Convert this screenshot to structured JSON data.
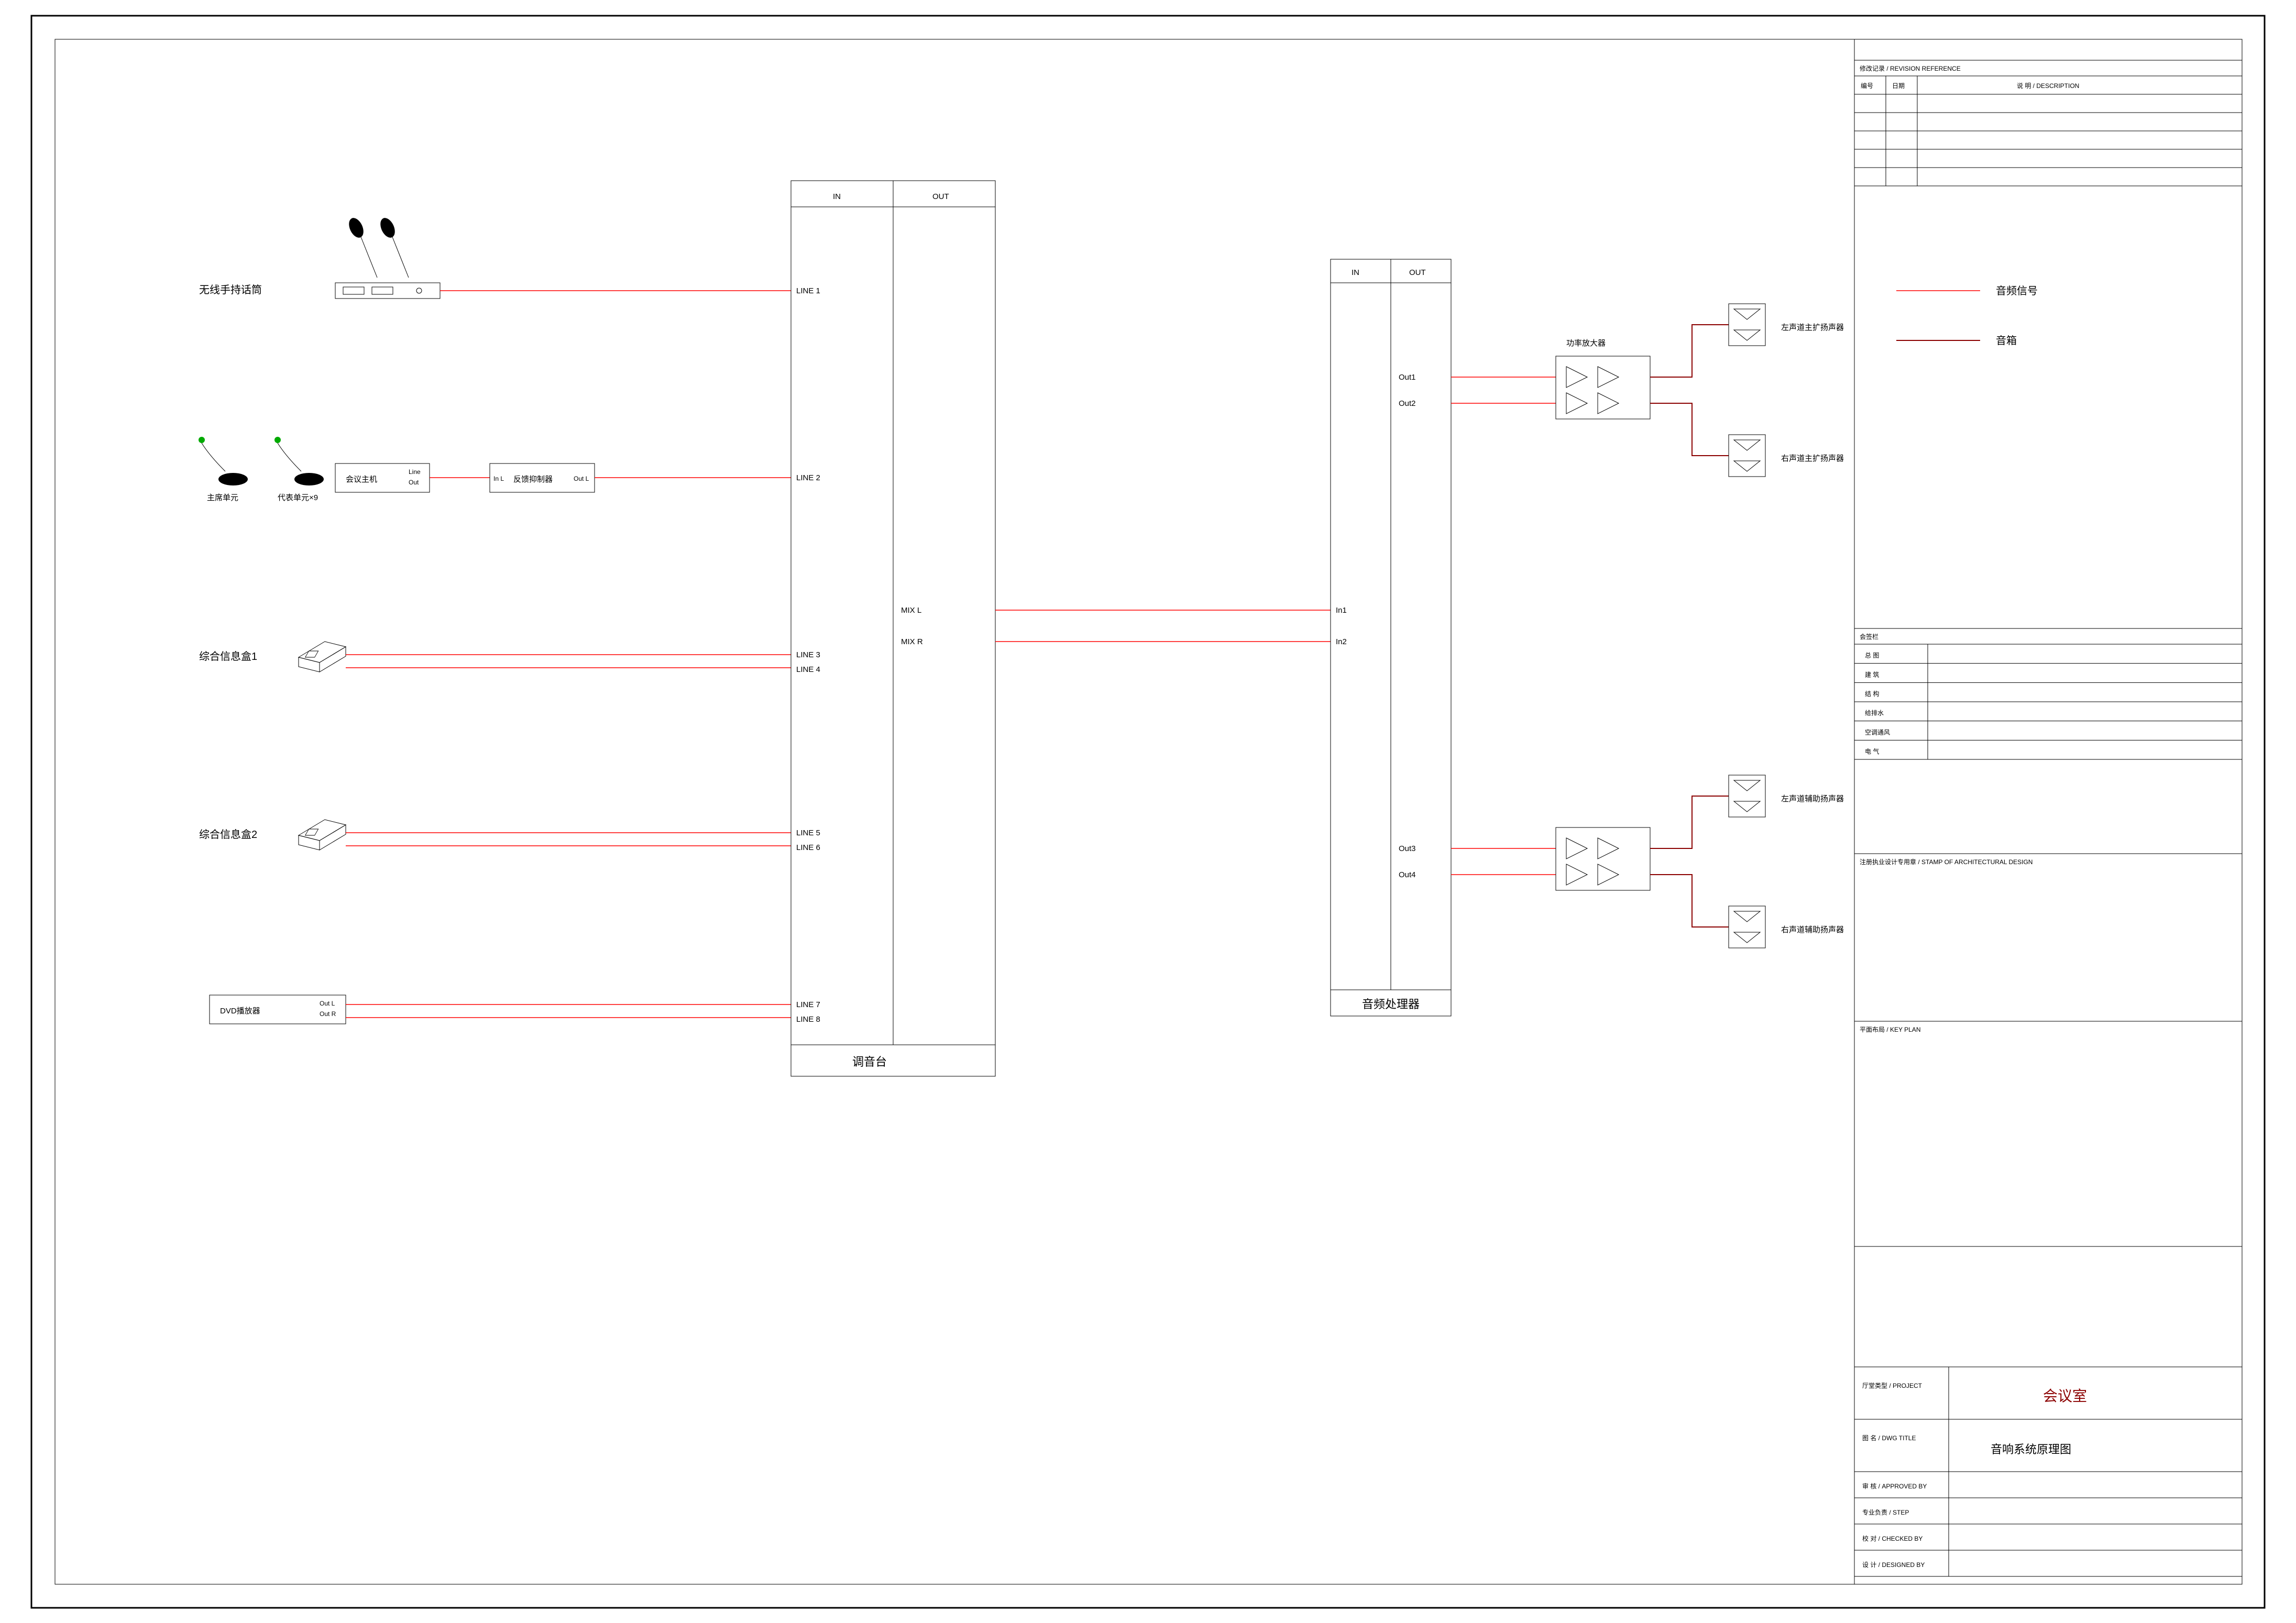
{
  "sources": {
    "wireless_mic": "无线手持话筒",
    "chairman_unit": "主席单元",
    "delegate_unit": "代表单元×9",
    "conf_host": "会议主机",
    "conf_host_line": "Line",
    "conf_host_out": "Out",
    "feedback": "反馈抑制器",
    "feedback_inL": "In L",
    "feedback_outL": "Out L",
    "info_box1": "综合信息盒1",
    "info_box2": "综合信息盒2",
    "dvd": "DVD播放器",
    "dvd_outL": "Out L",
    "dvd_outR": "Out R"
  },
  "mixer": {
    "title": "调音台",
    "in": "IN",
    "out": "OUT",
    "line1": "LINE 1",
    "line2": "LINE 2",
    "line3": "LINE 3",
    "line4": "LINE 4",
    "line5": "LINE 5",
    "line6": "LINE 6",
    "line7": "LINE 7",
    "line8": "LINE 8",
    "mixL": "MIX L",
    "mixR": "MIX R"
  },
  "processor": {
    "title": "音频处理器",
    "in": "IN",
    "out": "OUT",
    "in1": "In1",
    "in2": "In2",
    "out1": "Out1",
    "out2": "Out2",
    "out3": "Out3",
    "out4": "Out4"
  },
  "amp": {
    "power_amp": "功率放大器",
    "spk_main_L": "左声道主扩扬声器",
    "spk_main_R": "右声道主扩扬声器",
    "spk_aux_L": "左声道辅助扬声器",
    "spk_aux_R": "右声道辅助扬声器"
  },
  "legend": {
    "audio": "音频信号",
    "speaker": "音箱"
  },
  "titleblock": {
    "revision_header": "修改记录 / REVISION REFERENCE",
    "rev_no": "编号",
    "rev_date": "日期",
    "rev_desc": "说  明 / DESCRIPTION",
    "sign_header": "会签栏",
    "sign_rows": [
      "总  图",
      "建  筑",
      "结  构",
      "给排水",
      "空调通风",
      "电  气"
    ],
    "stamp": "注册执业设计专用章 / STAMP OF ARCHITECTURAL DESIGN",
    "plan": "平面布局 / KEY PLAN",
    "project_label": "厅堂类型 / PROJECT",
    "project_value": "会议室",
    "dwg_label": "图  名 / DWG TITLE",
    "dwg_value": "音响系统原理图",
    "approved": "审  核 / APPROVED  BY",
    "step": "专业负责 / STEP",
    "checked": "校  对 / CHECKED  BY",
    "designed": "设  计 / DESIGNED  BY"
  }
}
